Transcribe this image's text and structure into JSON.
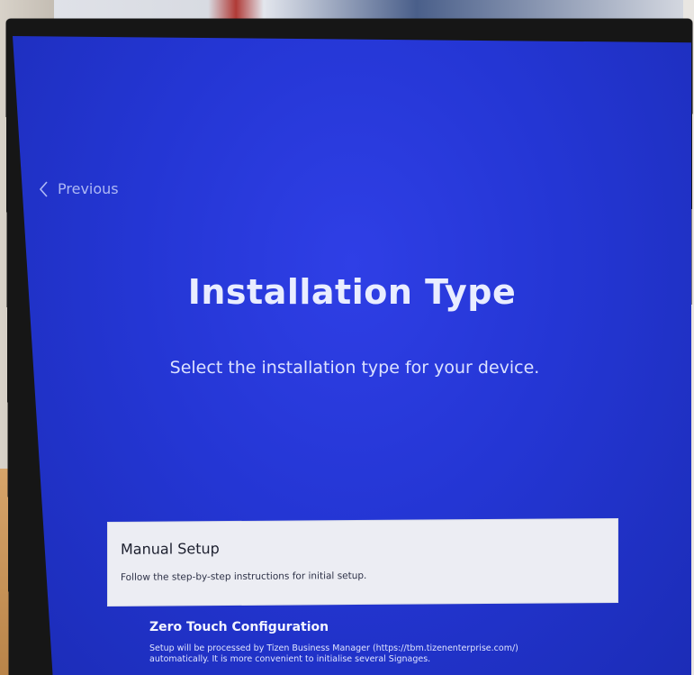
{
  "navigation": {
    "previous_label": "Previous"
  },
  "page": {
    "title": "Installation Type",
    "subtitle": "Select the installation type for your device."
  },
  "options": [
    {
      "title": "Manual Setup",
      "description": "Follow the step-by-step instructions for initial setup.",
      "selected": true
    },
    {
      "title": "Zero Touch Configuration",
      "description": "Setup will be processed by Tizen Business Manager (https://tbm.tizenenterprise.com/) automatically. It is more convenient to initialise several Signages.",
      "selected": false
    }
  ],
  "icons": {
    "previous": "chevron-left-icon"
  },
  "colors": {
    "screen_background": "#2436d4",
    "selected_option_background": "#ecedf3",
    "text_light": "#e9edff"
  }
}
